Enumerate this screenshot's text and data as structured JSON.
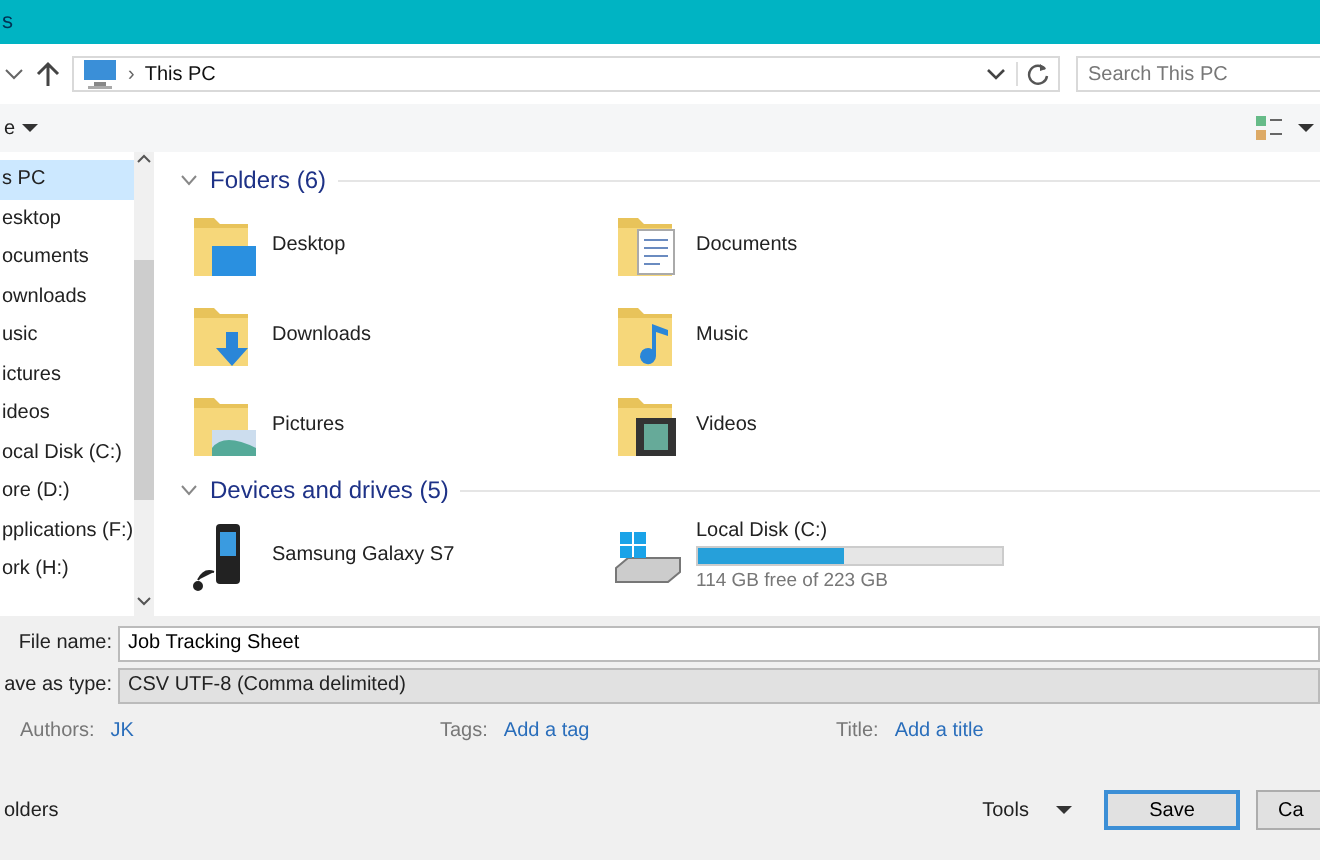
{
  "window": {
    "title": "s"
  },
  "address": {
    "path": "This PC",
    "separator": "›",
    "search_placeholder": "Search This PC"
  },
  "toolbar": {
    "organize": "e"
  },
  "sidebar": {
    "items": [
      {
        "label": "s PC",
        "selected": true
      },
      {
        "label": "esktop",
        "selected": false
      },
      {
        "label": "ocuments",
        "selected": false
      },
      {
        "label": "ownloads",
        "selected": false
      },
      {
        "label": "usic",
        "selected": false
      },
      {
        "label": "ictures",
        "selected": false
      },
      {
        "label": "ideos",
        "selected": false
      },
      {
        "label": "ocal Disk (C:)",
        "selected": false
      },
      {
        "label": "ore (D:)",
        "selected": false
      },
      {
        "label": "pplications (F:)",
        "selected": false
      },
      {
        "label": "ork (H:)",
        "selected": false
      }
    ]
  },
  "folders": {
    "heading": "Folders (6)",
    "items": [
      {
        "name": "Desktop",
        "kind": "desktop"
      },
      {
        "name": "Documents",
        "kind": "documents"
      },
      {
        "name": "Downloads",
        "kind": "downloads"
      },
      {
        "name": "Music",
        "kind": "music"
      },
      {
        "name": "Pictures",
        "kind": "pictures"
      },
      {
        "name": "Videos",
        "kind": "videos"
      }
    ]
  },
  "devices": {
    "heading": "Devices and drives (5)",
    "items": [
      {
        "name": "Samsung Galaxy S7",
        "kind": "phone"
      },
      {
        "name": "Local Disk (C:)",
        "kind": "disk",
        "level": 0.48,
        "free": "114 GB free of 223 GB"
      }
    ]
  },
  "form": {
    "file_name_label": "File name:",
    "file_name": "Job Tracking Sheet",
    "type_label": "ave as type:",
    "type": "CSV UTF-8 (Comma delimited)"
  },
  "meta": [
    {
      "label": "Authors:",
      "value": "JK"
    },
    {
      "label": "Tags:",
      "value": "Add a tag"
    },
    {
      "label": "Title:",
      "value": "Add a title"
    }
  ],
  "footer": {
    "folders": "olders",
    "tools": "Tools",
    "save": "Save",
    "cancel": "Ca"
  }
}
